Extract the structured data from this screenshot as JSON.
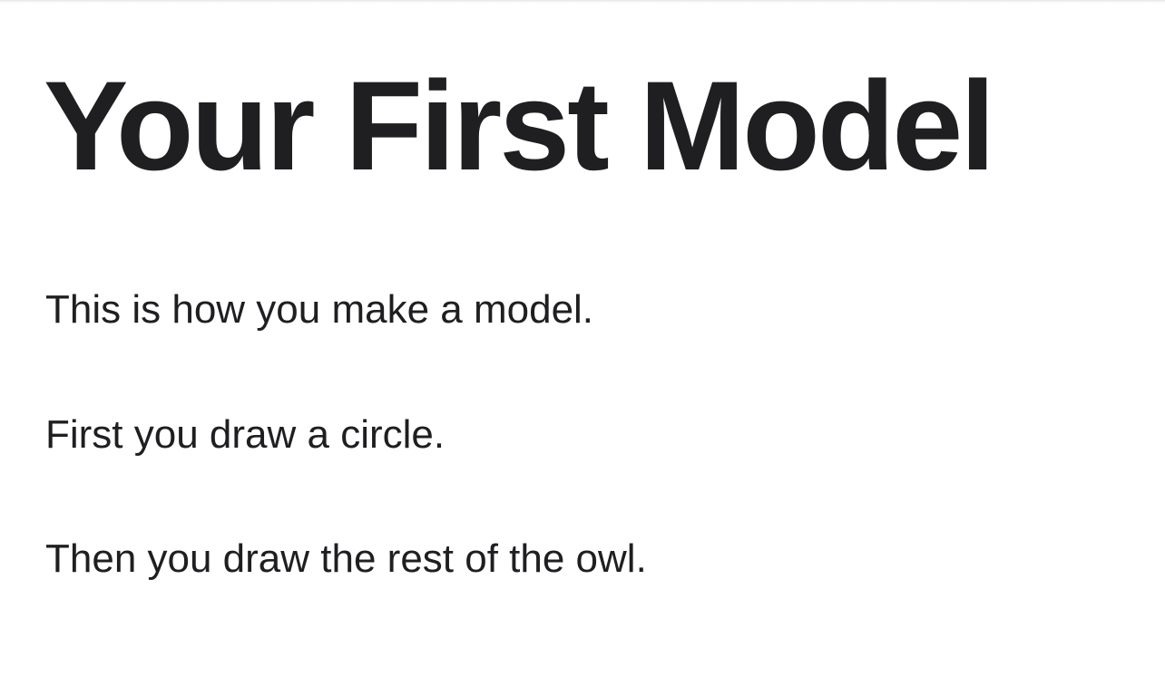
{
  "article": {
    "title": "Your First Model",
    "paragraphs": [
      "This is how you make a model.",
      "First you draw a circle.",
      "Then you draw the rest of the owl."
    ]
  },
  "colors": {
    "background": "#ffffff",
    "text": "#1f1f22"
  }
}
